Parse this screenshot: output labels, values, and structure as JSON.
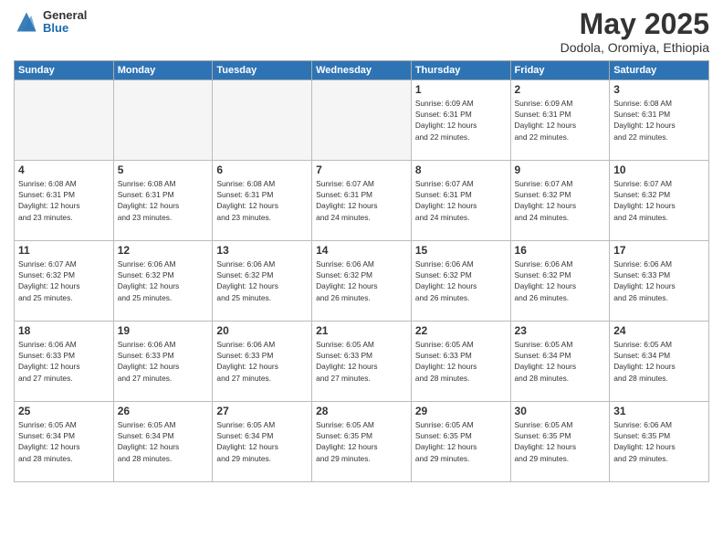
{
  "logo": {
    "general": "General",
    "blue": "Blue"
  },
  "title": "May 2025",
  "location": "Dodola, Oromiya, Ethiopia",
  "days_of_week": [
    "Sunday",
    "Monday",
    "Tuesday",
    "Wednesday",
    "Thursday",
    "Friday",
    "Saturday"
  ],
  "weeks": [
    [
      {
        "day": "",
        "info": ""
      },
      {
        "day": "",
        "info": ""
      },
      {
        "day": "",
        "info": ""
      },
      {
        "day": "",
        "info": ""
      },
      {
        "day": "1",
        "info": "Sunrise: 6:09 AM\nSunset: 6:31 PM\nDaylight: 12 hours\nand 22 minutes."
      },
      {
        "day": "2",
        "info": "Sunrise: 6:09 AM\nSunset: 6:31 PM\nDaylight: 12 hours\nand 22 minutes."
      },
      {
        "day": "3",
        "info": "Sunrise: 6:08 AM\nSunset: 6:31 PM\nDaylight: 12 hours\nand 22 minutes."
      }
    ],
    [
      {
        "day": "4",
        "info": "Sunrise: 6:08 AM\nSunset: 6:31 PM\nDaylight: 12 hours\nand 23 minutes."
      },
      {
        "day": "5",
        "info": "Sunrise: 6:08 AM\nSunset: 6:31 PM\nDaylight: 12 hours\nand 23 minutes."
      },
      {
        "day": "6",
        "info": "Sunrise: 6:08 AM\nSunset: 6:31 PM\nDaylight: 12 hours\nand 23 minutes."
      },
      {
        "day": "7",
        "info": "Sunrise: 6:07 AM\nSunset: 6:31 PM\nDaylight: 12 hours\nand 24 minutes."
      },
      {
        "day": "8",
        "info": "Sunrise: 6:07 AM\nSunset: 6:31 PM\nDaylight: 12 hours\nand 24 minutes."
      },
      {
        "day": "9",
        "info": "Sunrise: 6:07 AM\nSunset: 6:32 PM\nDaylight: 12 hours\nand 24 minutes."
      },
      {
        "day": "10",
        "info": "Sunrise: 6:07 AM\nSunset: 6:32 PM\nDaylight: 12 hours\nand 24 minutes."
      }
    ],
    [
      {
        "day": "11",
        "info": "Sunrise: 6:07 AM\nSunset: 6:32 PM\nDaylight: 12 hours\nand 25 minutes."
      },
      {
        "day": "12",
        "info": "Sunrise: 6:06 AM\nSunset: 6:32 PM\nDaylight: 12 hours\nand 25 minutes."
      },
      {
        "day": "13",
        "info": "Sunrise: 6:06 AM\nSunset: 6:32 PM\nDaylight: 12 hours\nand 25 minutes."
      },
      {
        "day": "14",
        "info": "Sunrise: 6:06 AM\nSunset: 6:32 PM\nDaylight: 12 hours\nand 26 minutes."
      },
      {
        "day": "15",
        "info": "Sunrise: 6:06 AM\nSunset: 6:32 PM\nDaylight: 12 hours\nand 26 minutes."
      },
      {
        "day": "16",
        "info": "Sunrise: 6:06 AM\nSunset: 6:32 PM\nDaylight: 12 hours\nand 26 minutes."
      },
      {
        "day": "17",
        "info": "Sunrise: 6:06 AM\nSunset: 6:33 PM\nDaylight: 12 hours\nand 26 minutes."
      }
    ],
    [
      {
        "day": "18",
        "info": "Sunrise: 6:06 AM\nSunset: 6:33 PM\nDaylight: 12 hours\nand 27 minutes."
      },
      {
        "day": "19",
        "info": "Sunrise: 6:06 AM\nSunset: 6:33 PM\nDaylight: 12 hours\nand 27 minutes."
      },
      {
        "day": "20",
        "info": "Sunrise: 6:06 AM\nSunset: 6:33 PM\nDaylight: 12 hours\nand 27 minutes."
      },
      {
        "day": "21",
        "info": "Sunrise: 6:05 AM\nSunset: 6:33 PM\nDaylight: 12 hours\nand 27 minutes."
      },
      {
        "day": "22",
        "info": "Sunrise: 6:05 AM\nSunset: 6:33 PM\nDaylight: 12 hours\nand 28 minutes."
      },
      {
        "day": "23",
        "info": "Sunrise: 6:05 AM\nSunset: 6:34 PM\nDaylight: 12 hours\nand 28 minutes."
      },
      {
        "day": "24",
        "info": "Sunrise: 6:05 AM\nSunset: 6:34 PM\nDaylight: 12 hours\nand 28 minutes."
      }
    ],
    [
      {
        "day": "25",
        "info": "Sunrise: 6:05 AM\nSunset: 6:34 PM\nDaylight: 12 hours\nand 28 minutes."
      },
      {
        "day": "26",
        "info": "Sunrise: 6:05 AM\nSunset: 6:34 PM\nDaylight: 12 hours\nand 28 minutes."
      },
      {
        "day": "27",
        "info": "Sunrise: 6:05 AM\nSunset: 6:34 PM\nDaylight: 12 hours\nand 29 minutes."
      },
      {
        "day": "28",
        "info": "Sunrise: 6:05 AM\nSunset: 6:35 PM\nDaylight: 12 hours\nand 29 minutes."
      },
      {
        "day": "29",
        "info": "Sunrise: 6:05 AM\nSunset: 6:35 PM\nDaylight: 12 hours\nand 29 minutes."
      },
      {
        "day": "30",
        "info": "Sunrise: 6:05 AM\nSunset: 6:35 PM\nDaylight: 12 hours\nand 29 minutes."
      },
      {
        "day": "31",
        "info": "Sunrise: 6:06 AM\nSunset: 6:35 PM\nDaylight: 12 hours\nand 29 minutes."
      }
    ]
  ]
}
